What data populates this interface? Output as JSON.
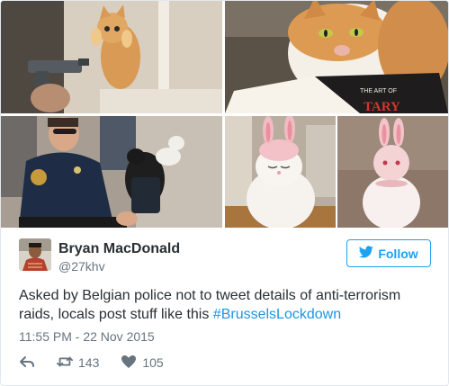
{
  "photos": [
    {
      "name": "kitten-photo"
    },
    {
      "name": "cat-reading-book-photo",
      "book_title": "THE ART OF"
    },
    {
      "name": "police-officer-cat-photo"
    },
    {
      "name": "bunny-hat-cat-photo"
    },
    {
      "name": "bunny-cat-figure-photo"
    }
  ],
  "tweet": {
    "author_name": "Bryan MacDonald",
    "author_handle": "@27khv",
    "follow_label": "Follow",
    "text_main": "Asked by Belgian police not to tweet details of anti-terrorism raids, locals post stuff like this ",
    "hashtag": "#BrusselsLockdown",
    "timestamp": "11:55 PM - 22 Nov 2015",
    "retweet_count": "143",
    "like_count": "105"
  },
  "colors": {
    "accent": "#1da1f2",
    "hashtag": "#1b95e0",
    "text": "#292f33",
    "muted": "#66757f",
    "border": "#e1e8ed"
  },
  "icons": {
    "follow": "bird-icon",
    "reply": "reply-icon",
    "retweet": "retweet-icon",
    "like": "heart-icon"
  }
}
